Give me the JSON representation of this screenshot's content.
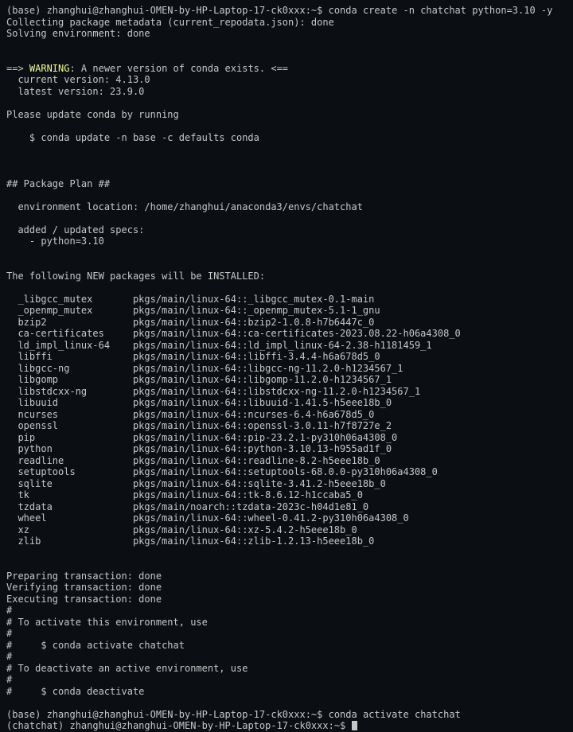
{
  "prompt1": {
    "env": "(base) ",
    "userhost": "zhanghui@zhanghui-OMEN-by-HP-Laptop-17-ck0xxx",
    "sep": ":",
    "path": "~",
    "dollar": "$ ",
    "cmd": "conda create -n chatchat python=3.10 -y"
  },
  "metadata_line": "Collecting package metadata (current_repodata.json): done",
  "solving_line": "Solving environment: done",
  "warn": {
    "lead": "==> ",
    "word": "WARNING",
    "rest": ": A newer version of conda exists. <=="
  },
  "current_version": "  current version: 4.13.0",
  "latest_version": "  latest version: 23.9.0",
  "please_update": "Please update conda by running",
  "update_cmd": "    $ conda update -n base -c defaults conda",
  "plan_head": "## Package Plan ##",
  "env_loc": "  environment location: /home/zhanghui/anaconda3/envs/chatchat",
  "added_specs": "  added / updated specs:",
  "spec_line": "    - python=3.10",
  "following": "The following NEW packages will be INSTALLED:",
  "packages": [
    {
      "name": "_libgcc_mutex",
      "spec": "pkgs/main/linux-64::_libgcc_mutex-0.1-main"
    },
    {
      "name": "_openmp_mutex",
      "spec": "pkgs/main/linux-64::_openmp_mutex-5.1-1_gnu"
    },
    {
      "name": "bzip2",
      "spec": "pkgs/main/linux-64::bzip2-1.0.8-h7b6447c_0"
    },
    {
      "name": "ca-certificates",
      "spec": "pkgs/main/linux-64::ca-certificates-2023.08.22-h06a4308_0"
    },
    {
      "name": "ld_impl_linux-64",
      "spec": "pkgs/main/linux-64::ld_impl_linux-64-2.38-h1181459_1"
    },
    {
      "name": "libffi",
      "spec": "pkgs/main/linux-64::libffi-3.4.4-h6a678d5_0"
    },
    {
      "name": "libgcc-ng",
      "spec": "pkgs/main/linux-64::libgcc-ng-11.2.0-h1234567_1"
    },
    {
      "name": "libgomp",
      "spec": "pkgs/main/linux-64::libgomp-11.2.0-h1234567_1"
    },
    {
      "name": "libstdcxx-ng",
      "spec": "pkgs/main/linux-64::libstdcxx-ng-11.2.0-h1234567_1"
    },
    {
      "name": "libuuid",
      "spec": "pkgs/main/linux-64::libuuid-1.41.5-h5eee18b_0"
    },
    {
      "name": "ncurses",
      "spec": "pkgs/main/linux-64::ncurses-6.4-h6a678d5_0"
    },
    {
      "name": "openssl",
      "spec": "pkgs/main/linux-64::openssl-3.0.11-h7f8727e_2"
    },
    {
      "name": "pip",
      "spec": "pkgs/main/linux-64::pip-23.2.1-py310h06a4308_0"
    },
    {
      "name": "python",
      "spec": "pkgs/main/linux-64::python-3.10.13-h955ad1f_0"
    },
    {
      "name": "readline",
      "spec": "pkgs/main/linux-64::readline-8.2-h5eee18b_0"
    },
    {
      "name": "setuptools",
      "spec": "pkgs/main/linux-64::setuptools-68.0.0-py310h06a4308_0"
    },
    {
      "name": "sqlite",
      "spec": "pkgs/main/linux-64::sqlite-3.41.2-h5eee18b_0"
    },
    {
      "name": "tk",
      "spec": "pkgs/main/linux-64::tk-8.6.12-h1ccaba5_0"
    },
    {
      "name": "tzdata",
      "spec": "pkgs/main/noarch::tzdata-2023c-h04d1e81_0"
    },
    {
      "name": "wheel",
      "spec": "pkgs/main/linux-64::wheel-0.41.2-py310h06a4308_0"
    },
    {
      "name": "xz",
      "spec": "pkgs/main/linux-64::xz-5.4.2-h5eee18b_0"
    },
    {
      "name": "zlib",
      "spec": "pkgs/main/linux-64::zlib-1.2.13-h5eee18b_0"
    }
  ],
  "prep": "Preparing transaction: done",
  "verify": "Verifying transaction: done",
  "exec": "Executing transaction: done",
  "h1": "#",
  "activate_msg": "# To activate this environment, use",
  "activate_cmd": "#     $ conda activate chatchat",
  "deactivate_msg": "# To deactivate an active environment, use",
  "deactivate_cmd": "#     $ conda deactivate",
  "prompt2": {
    "env": "(base) ",
    "userhost": "zhanghui@zhanghui-OMEN-by-HP-Laptop-17-ck0xxx",
    "sep": ":",
    "path": "~",
    "dollar": "$ ",
    "cmd": "conda activate chatchat"
  },
  "prompt3": {
    "env": "(chatchat) ",
    "userhost": "zhanghui@zhanghui-OMEN-by-HP-Laptop-17-ck0xxx",
    "sep": ":",
    "path": "~",
    "dollar": "$ "
  }
}
